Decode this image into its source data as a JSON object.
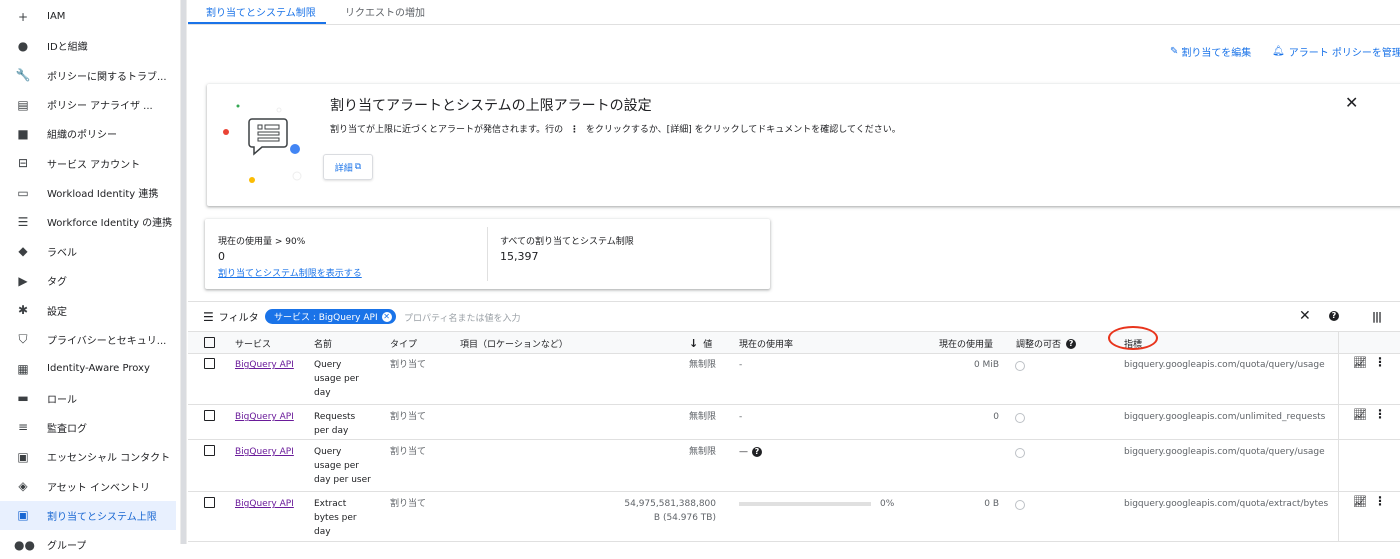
{
  "sidebar": {
    "items": [
      {
        "icon": "person-add-icon",
        "glyph": "+",
        "label": "IAM"
      },
      {
        "icon": "account-circle-icon",
        "glyph": "●",
        "label": "IDと組織"
      },
      {
        "icon": "wrench-icon",
        "glyph": "🔧",
        "label": "ポリシーに関するトラブ..."
      },
      {
        "icon": "policy-analyzer-icon",
        "glyph": "▤",
        "label": "ポリシー アナライザ ..."
      },
      {
        "icon": "org-policy-icon",
        "glyph": "■",
        "label": "組織のポリシー"
      },
      {
        "icon": "service-account-icon",
        "glyph": "⊟",
        "label": "サービス アカウント"
      },
      {
        "icon": "workload-identity-icon",
        "glyph": "▭",
        "label": "Workload Identity 連携"
      },
      {
        "icon": "workforce-identity-icon",
        "glyph": "☰",
        "label": "Workforce Identity の連携"
      },
      {
        "icon": "label-icon",
        "glyph": "◆",
        "label": "ラベル"
      },
      {
        "icon": "tag-icon",
        "glyph": "▶",
        "label": "タグ"
      },
      {
        "icon": "settings-icon",
        "glyph": "✱",
        "label": "設定"
      },
      {
        "icon": "shield-icon",
        "glyph": "⛉",
        "label": "プライバシーとセキュリ..."
      },
      {
        "icon": "iap-icon",
        "glyph": "▦",
        "label": "Identity-Aware Proxy"
      },
      {
        "icon": "role-icon",
        "glyph": "▬",
        "label": "ロール"
      },
      {
        "icon": "audit-log-icon",
        "glyph": "≡",
        "label": "監査ログ"
      },
      {
        "icon": "contact-icon",
        "glyph": "▣",
        "label": "エッセンシャル コンタクト"
      },
      {
        "icon": "asset-inventory-icon",
        "glyph": "◈",
        "label": "アセット インベントリ"
      },
      {
        "icon": "quota-icon",
        "glyph": "▣",
        "label": "割り当てとシステム上限",
        "active": true
      },
      {
        "icon": "group-icon",
        "glyph": "●●",
        "label": "グループ"
      }
    ]
  },
  "tabs": [
    "割り当てとシステム制限",
    "リクエストの増加"
  ],
  "toplinks": {
    "edit_quota": "割り当てを編集",
    "manage_alert": "アラート ポリシーを管理"
  },
  "banner": {
    "title": "割り当てアラートとシステムの上限アラートの設定",
    "desc_before": "割り当てが上限に近づくとアラートが発信されます。行の",
    "desc_after": "をクリックするか、[詳細] をクリックしてドキュメントを確認してください。",
    "details_button": "詳細"
  },
  "usage": {
    "current_label": "現在の使用量 > 90%",
    "current_value": "0",
    "current_link": "割り当てとシステム制限を表示する",
    "all_label": "すべての割り当てとシステム制限",
    "all_value": "15,397"
  },
  "filter": {
    "label": "フィルタ",
    "chip": "サービス : BigQuery API",
    "placeholder": "プロパティ名または値を入力"
  },
  "table": {
    "headers": {
      "service": "サービス",
      "name": "名前",
      "type": "タイプ",
      "dimension": "項目（ロケーションなど）",
      "value": "値",
      "usage_rate": "現在の使用率",
      "usage": "現在の使用量",
      "adjustable": "調整の可否",
      "metric": "指標"
    },
    "rows": [
      {
        "service": "BigQuery API",
        "name": [
          "Query",
          "usage per",
          "day"
        ],
        "type": "割り当て",
        "value": "無制限",
        "value2": "",
        "rate": "-",
        "usage": "0 MiB",
        "metric": "bigquery.googleapis.com/quota/query/usage",
        "actions": true
      },
      {
        "service": "BigQuery API",
        "name": [
          "Requests",
          "per day"
        ],
        "type": "割り当て",
        "value": "無制限",
        "value2": "",
        "rate": "-",
        "usage": "0",
        "metric": "bigquery.googleapis.com/unlimited_requests",
        "actions": true
      },
      {
        "service": "BigQuery API",
        "name": [
          "Query",
          "usage per",
          "day per user"
        ],
        "type": "割り当て",
        "value": "無制限",
        "value2": "",
        "rate": "—",
        "usage": "",
        "metric": "bigquery.googleapis.com/quota/query/usage",
        "actions": false
      },
      {
        "service": "BigQuery API",
        "name": [
          "Extract",
          "bytes per",
          "day"
        ],
        "type": "割り当て",
        "value": "54,975,581,388,800",
        "value2": "B (54.976 TB)",
        "rate": "0%",
        "usage": "0 B",
        "metric": "bigquery.googleapis.com/quota/extract/bytes",
        "actions": true
      }
    ]
  }
}
